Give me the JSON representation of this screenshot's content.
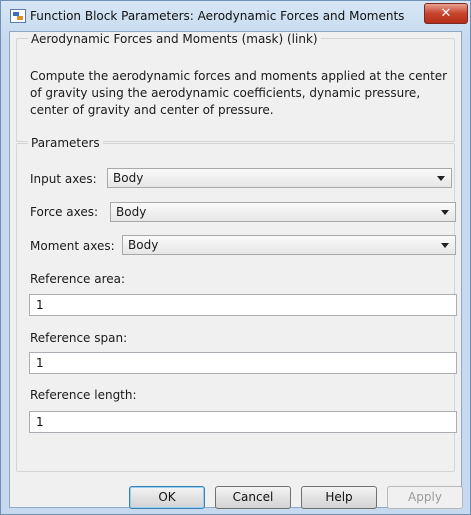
{
  "window": {
    "title": "Function Block Parameters: Aerodynamic Forces and Moments",
    "close_label": "✕"
  },
  "block": {
    "group_title": "Aerodynamic Forces and Moments (mask) (link)",
    "description": "Compute the aerodynamic forces and moments applied at the center of gravity using the aerodynamic coefficients, dynamic pressure, center of gravity and center of pressure."
  },
  "parameters": {
    "group_title": "Parameters",
    "input_axes": {
      "label": "Input axes:",
      "value": "Body"
    },
    "force_axes": {
      "label": "Force axes:",
      "value": "Body"
    },
    "moment_axes": {
      "label": "Moment axes:",
      "value": "Body"
    },
    "reference_area": {
      "label": "Reference area:",
      "value": "1"
    },
    "reference_span": {
      "label": "Reference span:",
      "value": "1"
    },
    "reference_length": {
      "label": "Reference length:",
      "value": "1"
    }
  },
  "buttons": {
    "ok": "OK",
    "cancel": "Cancel",
    "help": "Help",
    "apply": "Apply"
  }
}
